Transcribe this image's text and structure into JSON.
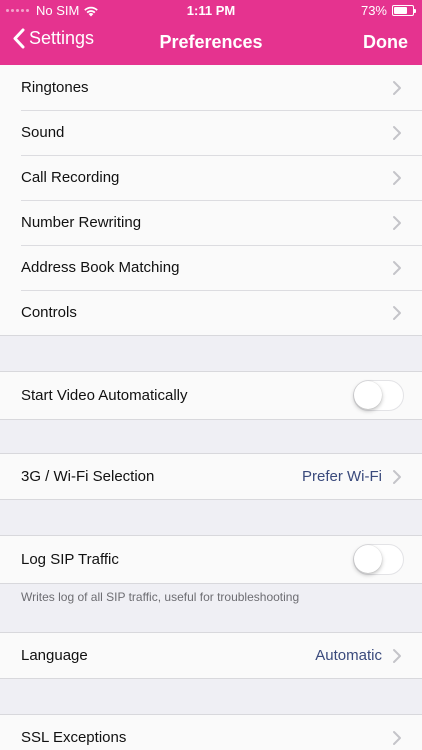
{
  "status_bar": {
    "carrier": "No SIM",
    "time": "1:11 PM",
    "battery_percent": "73%",
    "battery_level": 0.73
  },
  "nav": {
    "back_label": "Settings",
    "title": "Preferences",
    "done_label": "Done"
  },
  "groups": {
    "main": {
      "ringtones": "Ringtones",
      "sound": "Sound",
      "call_recording": "Call Recording",
      "number_rewriting": "Number Rewriting",
      "address_book_matching": "Address Book Matching",
      "controls": "Controls"
    },
    "video": {
      "start_video_label": "Start Video Automatically",
      "start_video_on": false
    },
    "network": {
      "label": "3G / Wi-Fi Selection",
      "value": "Prefer Wi-Fi"
    },
    "sip": {
      "label": "Log SIP Traffic",
      "on": false,
      "footer": "Writes log of all SIP traffic, useful for troubleshooting"
    },
    "language": {
      "label": "Language",
      "value": "Automatic"
    },
    "ssl": {
      "label": "SSL Exceptions"
    }
  },
  "colors": {
    "accent": "#e5338f",
    "value_text": "#3a4a7c"
  }
}
